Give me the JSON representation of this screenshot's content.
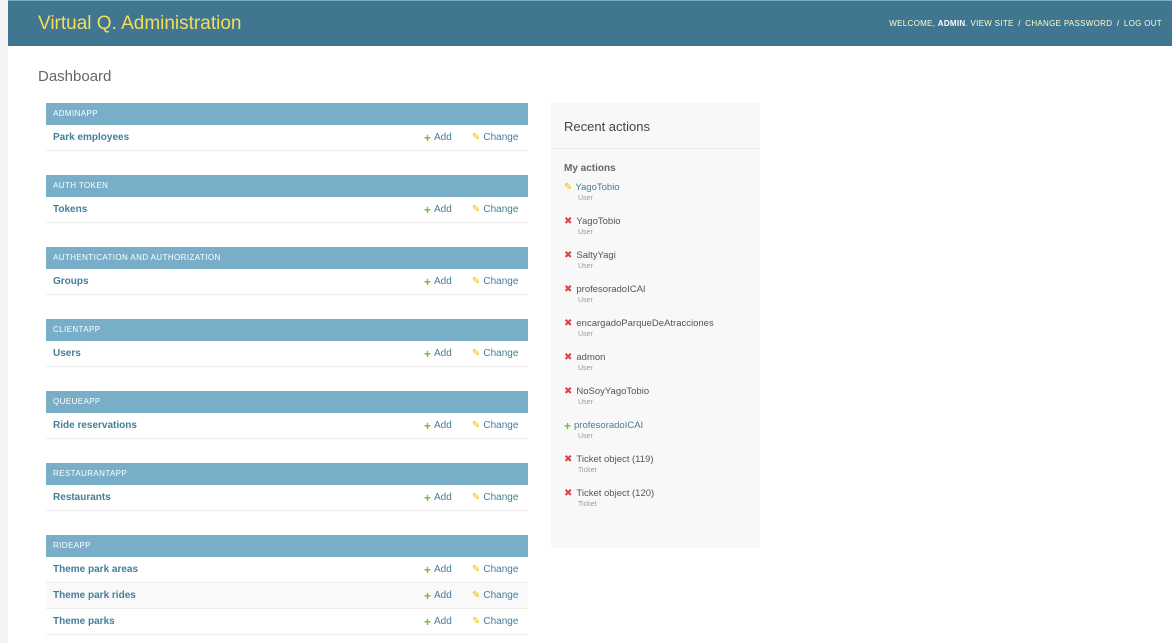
{
  "header": {
    "brand": "Virtual Q. Administration",
    "welcome": "Welcome,",
    "username": "admin",
    "view_site": "View site",
    "change_password": "Change password",
    "log_out": "Log out",
    "sep": "/",
    "colors": {
      "header_bg": "#417690",
      "brand": "#f5dd5d",
      "caption_bg": "#79aec8"
    }
  },
  "page_title": "Dashboard",
  "modules": [
    {
      "caption": "ADMINAPP",
      "rows": [
        {
          "name": "Park employees",
          "add": "Add",
          "change": "Change"
        }
      ]
    },
    {
      "caption": "AUTH TOKEN",
      "rows": [
        {
          "name": "Tokens",
          "add": "Add",
          "change": "Change"
        }
      ]
    },
    {
      "caption": "AUTHENTICATION AND AUTHORIZATION",
      "rows": [
        {
          "name": "Groups",
          "add": "Add",
          "change": "Change"
        }
      ]
    },
    {
      "caption": "CLIENTAPP",
      "rows": [
        {
          "name": "Users",
          "add": "Add",
          "change": "Change"
        }
      ]
    },
    {
      "caption": "QUEUEAPP",
      "rows": [
        {
          "name": "Ride reservations",
          "add": "Add",
          "change": "Change"
        }
      ]
    },
    {
      "caption": "RESTAURANTAPP",
      "rows": [
        {
          "name": "Restaurants",
          "add": "Add",
          "change": "Change"
        }
      ]
    },
    {
      "caption": "RIDEAPP",
      "rows": [
        {
          "name": "Theme park areas",
          "add": "Add",
          "change": "Change"
        },
        {
          "name": "Theme park rides",
          "add": "Add",
          "change": "Change"
        },
        {
          "name": "Theme parks",
          "add": "Add",
          "change": "Change"
        }
      ]
    }
  ],
  "recent": {
    "title": "Recent actions",
    "subtitle": "My actions",
    "actions": [
      {
        "icon": "pencil-icon",
        "name": "YagoTobio",
        "type": "User",
        "linked": true
      },
      {
        "icon": "x-icon",
        "name": "YagoTobio",
        "type": "User",
        "linked": false
      },
      {
        "icon": "x-icon",
        "name": "SaltyYagi",
        "type": "User",
        "linked": false
      },
      {
        "icon": "x-icon",
        "name": "profesoradoICAI",
        "type": "User",
        "linked": false
      },
      {
        "icon": "x-icon",
        "name": "encargadoParqueDeAtracciones",
        "type": "User",
        "linked": false
      },
      {
        "icon": "x-icon",
        "name": "admon",
        "type": "User",
        "linked": false
      },
      {
        "icon": "x-icon",
        "name": "NoSoyYagoTobio",
        "type": "User",
        "linked": false
      },
      {
        "icon": "plus-icon",
        "name": "profesoradoICAI",
        "type": "User",
        "linked": true
      },
      {
        "icon": "x-icon",
        "name": "Ticket object (119)",
        "type": "Ticket",
        "linked": false
      },
      {
        "icon": "x-icon",
        "name": "Ticket object (120)",
        "type": "Ticket",
        "linked": false
      }
    ]
  }
}
